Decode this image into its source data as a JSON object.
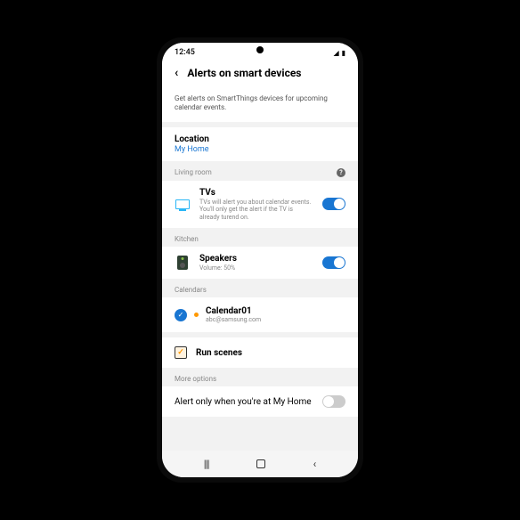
{
  "status": {
    "time": "12:45",
    "signal": "◢",
    "battery": "▮"
  },
  "header": {
    "title": "Alerts on smart devices"
  },
  "intro": "Get alerts on SmartThings devices for upcoming calendar events.",
  "location": {
    "label": "Location",
    "value": "My Home"
  },
  "sections": {
    "living_room": {
      "title": "Living room"
    },
    "kitchen": {
      "title": "Kitchen"
    },
    "calendars": {
      "title": "Calendars"
    },
    "more_options": {
      "title": "More options"
    }
  },
  "devices": {
    "tv": {
      "name": "TVs",
      "desc": "TVs will alert you about calendar events. You'll only get the alert if the TV is already turend on."
    },
    "speaker": {
      "name": "Speakers",
      "desc": "Volume: 50%"
    }
  },
  "calendar": {
    "name": "Calendar01",
    "email": "abc@samsung.com"
  },
  "scenes": {
    "label": "Run scenes"
  },
  "option": {
    "label": "Alert only when you're at My Home"
  }
}
